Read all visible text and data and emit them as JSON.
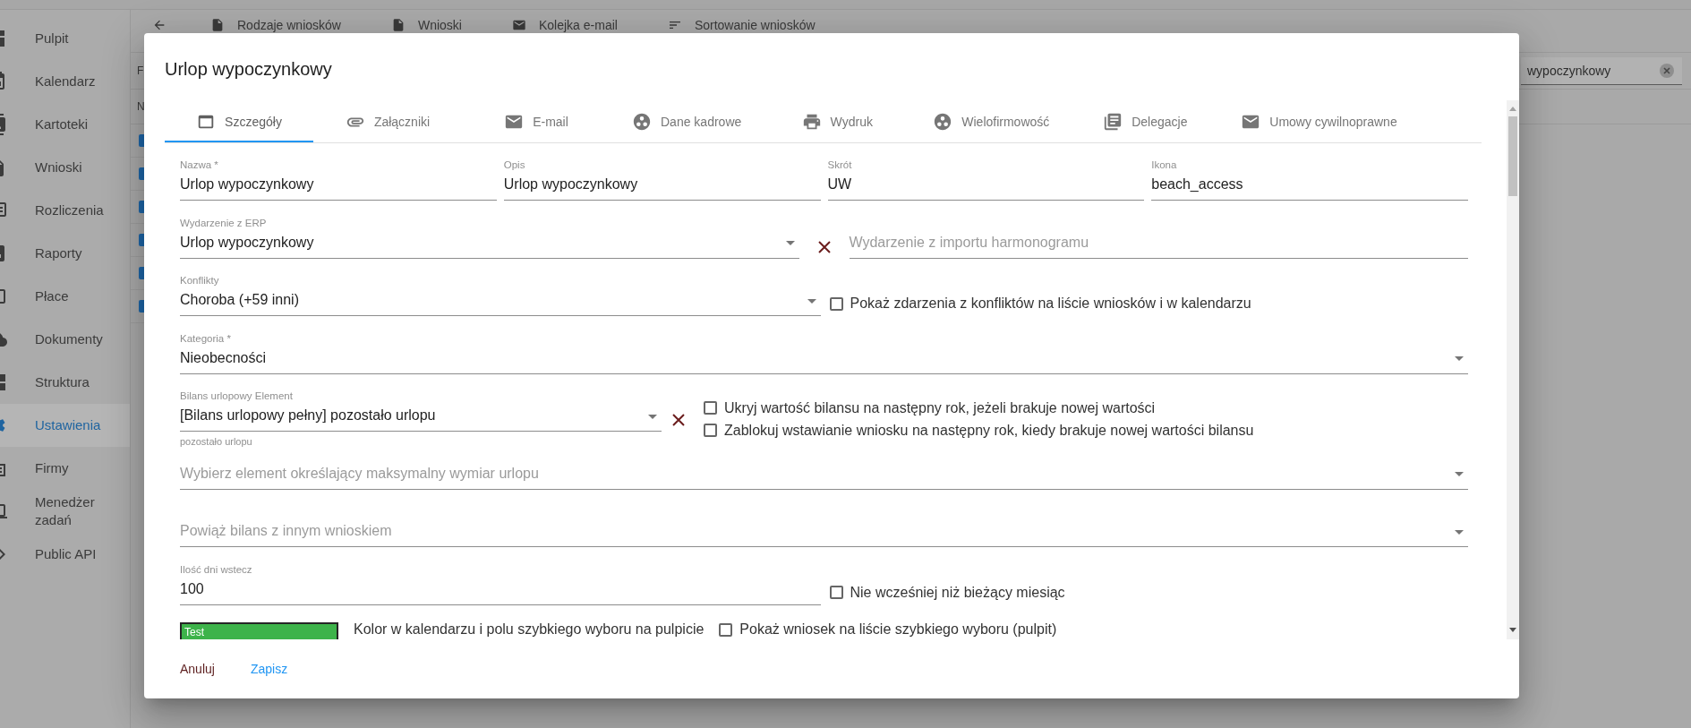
{
  "sidebar": {
    "items": [
      {
        "label": "Pulpit",
        "selected": false
      },
      {
        "label": "Kalendarz",
        "selected": false
      },
      {
        "label": "Kartoteki",
        "selected": false
      },
      {
        "label": "Wnioski",
        "selected": false
      },
      {
        "label": "Rozliczenia",
        "selected": false
      },
      {
        "label": "Raporty",
        "selected": false
      },
      {
        "label": "Płace",
        "selected": false
      },
      {
        "label": "Dokumenty",
        "selected": false
      },
      {
        "label": "Struktura",
        "selected": false
      },
      {
        "label": "Ustawienia",
        "selected": true
      },
      {
        "label": "Firmy",
        "selected": false
      },
      {
        "label": "Menedżer zadań",
        "selected": false
      },
      {
        "label": "Public API",
        "selected": false
      }
    ]
  },
  "toolbar": {
    "items": [
      {
        "label": "Rodzaje wniosków"
      },
      {
        "label": "Wnioski"
      },
      {
        "label": "Kolejka e-mail"
      },
      {
        "label": "Sortowanie wniosków"
      }
    ]
  },
  "table": {
    "filter_label": "F",
    "search": {
      "value": "wypoczynkowy"
    },
    "column_header": "N",
    "rows": [
      {
        "marked": true
      },
      {
        "marked": true
      },
      {
        "marked": true
      },
      {
        "marked": true
      },
      {
        "marked": true
      },
      {
        "marked": true
      }
    ]
  },
  "dialog": {
    "title": "Urlop wypoczynkowy",
    "tabs": [
      {
        "label": "Szczegóły",
        "selected": true
      },
      {
        "label": "Załączniki",
        "selected": false
      },
      {
        "label": "E-mail",
        "selected": false
      },
      {
        "label": "Dane kadrowe",
        "selected": false
      },
      {
        "label": "Wydruk",
        "selected": false
      },
      {
        "label": "Wielofirmowość",
        "selected": false
      },
      {
        "label": "Delegacje",
        "selected": false
      },
      {
        "label": "Umowy cywilnoprawne",
        "selected": false
      }
    ],
    "form": {
      "rows": [
        {
          "kind": "quad",
          "fields": [
            {
              "kind": "text",
              "label": "Nazwa *",
              "value": "Urlop wypoczynkowy"
            },
            {
              "kind": "text",
              "label": "Opis",
              "value": "Urlop wypoczynkowy"
            },
            {
              "kind": "text",
              "label": "Skrót",
              "value": "UW"
            },
            {
              "kind": "text",
              "label": "Ikona",
              "value": "beach_access"
            }
          ]
        },
        {
          "kind": "pair",
          "fields": [
            {
              "kind": "select",
              "label": "Wydarzenie z ERP",
              "value": "Urlop wypoczynkowy"
            },
            {
              "kind": "clear"
            },
            {
              "kind": "text",
              "placeholder": "Wydarzenie z importu harmonogramu"
            }
          ]
        },
        {
          "kind": "half",
          "fields": [
            {
              "kind": "select",
              "label": "Konflikty",
              "value": "Choroba (+59 inni)"
            },
            {
              "kind": "checkbox",
              "label": "Pokaż zdarzenia z konfliktów na liście wniosków i w kalendarzu",
              "checked": false
            }
          ]
        },
        {
          "kind": "full",
          "fields": [
            {
              "kind": "select",
              "label": "Kategoria *",
              "value": "Nieobecności"
            }
          ]
        },
        {
          "kind": "balance",
          "fields": [
            {
              "kind": "select",
              "label": "Bilans urlopowy Element",
              "value": "[Bilans urlopowy pełny] pozostało urlopu",
              "helper_text": "pozostało urlopu"
            },
            {
              "kind": "clear"
            },
            {
              "kind": "checkboxes",
              "items": [
                {
                  "label": "Ukryj wartość bilansu na następny rok, jeżeli brakuje nowej wartości",
                  "checked": false
                },
                {
                  "label": "Zablokuj wstawianie wniosku na następny rok, kiedy brakuje nowej wartości bilansu",
                  "checked": false
                }
              ]
            }
          ]
        },
        {
          "kind": "full",
          "fields": [
            {
              "kind": "select",
              "placeholder": "Wybierz element określający maksymalny wymiar urlopu"
            }
          ]
        },
        {
          "kind": "full",
          "fields": [
            {
              "kind": "select",
              "placeholder": "Powiąż bilans z innym wnioskiem"
            }
          ]
        },
        {
          "kind": "half",
          "fields": [
            {
              "kind": "text",
              "label": "Ilość dni wstecz",
              "value": "100"
            },
            {
              "kind": "checkbox",
              "label": "Nie wcześniej niż bieżący miesiąc",
              "checked": false
            }
          ]
        },
        {
          "kind": "color",
          "fields": [
            {
              "kind": "color",
              "label": "Test",
              "color": "#3db34a"
            },
            {
              "kind": "caption",
              "text": "Kolor w kalendarzu i polu szybkiego wyboru na pulpicie"
            },
            {
              "kind": "checkbox",
              "label": "Pokaż wniosek na liście szybkiego wyboru (pulpit)",
              "checked": false
            }
          ]
        }
      ]
    },
    "actions": [
      {
        "label": "Anuluj",
        "kind": "cancel"
      },
      {
        "label": "Zapisz",
        "kind": "confirm"
      }
    ]
  }
}
